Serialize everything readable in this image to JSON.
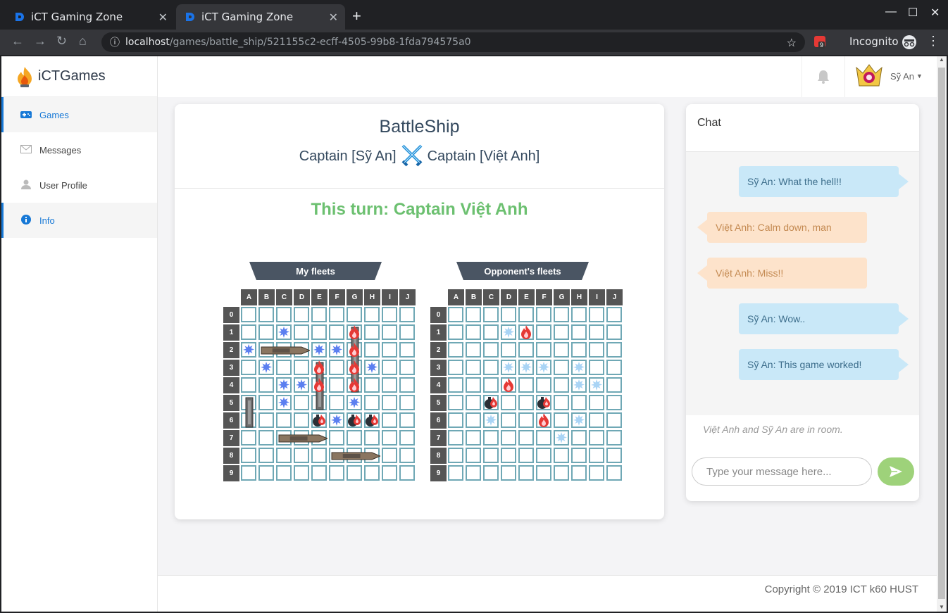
{
  "browser": {
    "tabs": [
      {
        "title": "iCT Gaming Zone"
      },
      {
        "title": "iCT Gaming Zone"
      }
    ],
    "url_host": "localhost",
    "url_path": "/games/battle_ship/521155c2-ecff-4505-99b8-1fda794575a0",
    "profile": "Incognito",
    "extension_badge": "9"
  },
  "sidebar": {
    "brand": "iCTGames",
    "items": [
      {
        "label": "Games",
        "icon": "gamepad-icon",
        "active": true
      },
      {
        "label": "Messages",
        "icon": "envelope-icon",
        "active": false
      },
      {
        "label": "User Profile",
        "icon": "user-icon",
        "active": false
      },
      {
        "label": "Info",
        "icon": "info-icon",
        "active": true
      }
    ]
  },
  "topbar": {
    "user_name": "Sỹ An"
  },
  "game": {
    "title": "BattleShip",
    "captain_left": "Captain [Sỹ An]",
    "captain_right": "Captain [Việt Anh]",
    "turn": "This turn: Captain Việt Anh",
    "columns": [
      "A",
      "B",
      "C",
      "D",
      "E",
      "F",
      "G",
      "H",
      "I",
      "J"
    ],
    "rows": [
      "0",
      "1",
      "2",
      "3",
      "4",
      "5",
      "6",
      "7",
      "8",
      "9"
    ],
    "my_fleet": {
      "label": "My fleets",
      "misses": [
        "C1",
        "A2",
        "E2",
        "F2",
        "B3",
        "H3",
        "C4",
        "D4",
        "C5",
        "G5",
        "F6"
      ],
      "hits": [
        "G1",
        "G2",
        "E3",
        "G3",
        "E4",
        "G4"
      ],
      "sunk": [
        "E6",
        "G6",
        "H6"
      ],
      "ships": [
        {
          "orientation": "horizontal",
          "cells": [
            "B2",
            "C2",
            "D2"
          ]
        },
        {
          "orientation": "vertical",
          "cells": [
            "G1",
            "G2",
            "G3",
            "G4"
          ]
        },
        {
          "orientation": "vertical",
          "cells": [
            "E3",
            "E4",
            "E5"
          ]
        },
        {
          "orientation": "vertical",
          "cells": [
            "A5",
            "A6"
          ]
        },
        {
          "orientation": "horizontal",
          "cells": [
            "C7",
            "D7",
            "E7"
          ]
        },
        {
          "orientation": "horizontal",
          "cells": [
            "F8",
            "G8",
            "H8"
          ]
        }
      ]
    },
    "opponent_fleet": {
      "label": "Opponent's fleets",
      "misses": [
        "D1",
        "D3",
        "E3",
        "F3",
        "H3",
        "H4",
        "I4",
        "C6",
        "H6",
        "G7"
      ],
      "hits": [
        "E1",
        "D4",
        "F6"
      ],
      "sunk": [
        "C5",
        "F5"
      ]
    }
  },
  "chat": {
    "title": "Chat",
    "messages": [
      {
        "from": "me",
        "text": "Sỹ An: What the hell!!"
      },
      {
        "from": "them",
        "text": "Việt Anh: Calm down, man"
      },
      {
        "from": "them",
        "text": "Việt Anh: Miss!!"
      },
      {
        "from": "me",
        "text": "Sỹ An: Wow.."
      },
      {
        "from": "me",
        "text": "Sỹ An: This game worked!"
      }
    ],
    "presence": "Việt Anh and Sỹ An are in room.",
    "input_placeholder": "Type your message here..."
  },
  "footer": {
    "copyright": "Copyright © 2019 ICT k60 HUST"
  },
  "colors": {
    "accent": "#1678d6",
    "turn": "#6cc070",
    "grid": "#6fa8b5",
    "send": "#9ed27a"
  }
}
